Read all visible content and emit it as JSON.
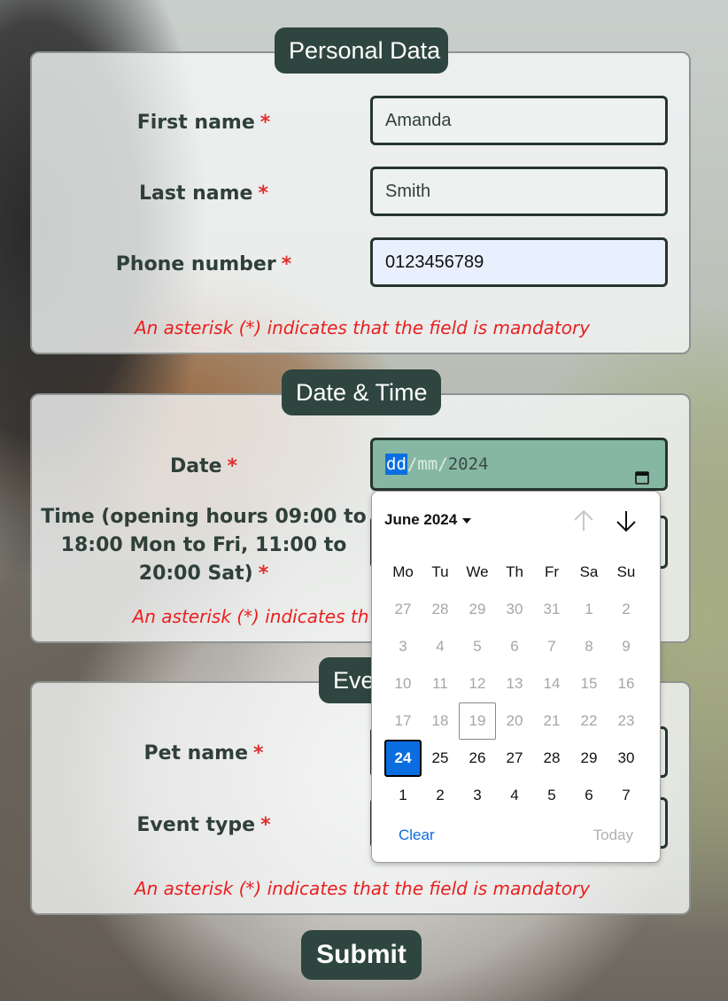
{
  "personal": {
    "legend": "Personal Data",
    "first_label": "First name",
    "first_value": "Amanda",
    "last_label": "Last name",
    "last_value": "Smith",
    "phone_label": "Phone number",
    "phone_value": "0123456789",
    "note": "An asterisk (*) indicates that the field is mandatory"
  },
  "datetime": {
    "legend": "Date & Time",
    "date_label": "Date",
    "date_dd": "dd",
    "date_mm": "mm",
    "date_yyyy": "2024",
    "time_label_l1": "Time (opening hours 09:00 to",
    "time_label_l2": "18:00 Mon to Fri, 11:00 to",
    "time_label_l3": "20:00 Sat)",
    "note": "An asterisk (*) indicates th"
  },
  "event": {
    "legend": "Eve",
    "pet_label": "Pet name",
    "type_label": "Event type",
    "note": "An asterisk (*) indicates that the field is mandatory"
  },
  "asterisk": "*",
  "submit_label": "Submit",
  "calendar": {
    "month": "June 2024",
    "weekdays": [
      "Mo",
      "Tu",
      "We",
      "Th",
      "Fr",
      "Sa",
      "Su"
    ],
    "weeks": [
      [
        "27",
        "28",
        "29",
        "30",
        "31",
        "1",
        "2"
      ],
      [
        "3",
        "4",
        "5",
        "6",
        "7",
        "8",
        "9"
      ],
      [
        "10",
        "11",
        "12",
        "13",
        "14",
        "15",
        "16"
      ],
      [
        "17",
        "18",
        "19",
        "20",
        "21",
        "22",
        "23"
      ],
      [
        "24",
        "25",
        "26",
        "27",
        "28",
        "29",
        "30"
      ],
      [
        "1",
        "2",
        "3",
        "4",
        "5",
        "6",
        "7"
      ]
    ],
    "selected": "24",
    "today": "19",
    "clear_label": "Clear",
    "today_label": "Today",
    "accent": "#0b6ee0"
  }
}
